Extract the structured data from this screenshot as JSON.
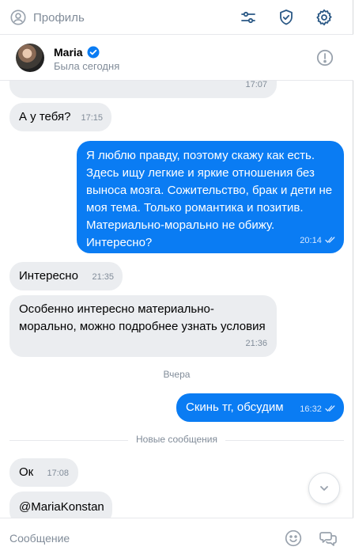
{
  "topbar": {
    "profile_label": "Профиль",
    "icons": [
      "user-circle-icon",
      "sliders-icon",
      "shield-check-icon",
      "gear-icon"
    ]
  },
  "chat": {
    "name": "Maria",
    "verified": true,
    "status": "Была сегодня"
  },
  "messages": [
    {
      "dir": "in",
      "text": "",
      "time": "17:07"
    },
    {
      "dir": "in",
      "text": "А у тебя?",
      "time": "17:15"
    },
    {
      "dir": "out",
      "lines": [
        "Я люблю правду, поэтому скажу как есть.",
        "Здесь ищу легкие и яркие отношения без",
        "выноса мозга. Сожительство, брак и дети не",
        "моя тема. Только романтика и позитив.",
        "Материально-морально не обижу.",
        "Интересно?"
      ],
      "time": "20:14",
      "read": true
    },
    {
      "dir": "in",
      "text": "Интересно",
      "time": "21:35"
    },
    {
      "dir": "in",
      "lines": [
        "Особенно интересно материально-",
        "морально, можно подробнее узнать условия"
      ],
      "time": "21:36"
    },
    {
      "dir": "out",
      "text": "Скинь тг, обсудим",
      "time": "16:32",
      "read": true
    },
    {
      "dir": "in",
      "text": "Ок",
      "time": "17:08"
    },
    {
      "dir": "in",
      "text": "@MariaKonstan",
      "time": ""
    }
  ],
  "dividers": {
    "date": "Вчера",
    "new_messages": "Новые сообщения"
  },
  "composer": {
    "placeholder": "Сообщение"
  },
  "colors": {
    "outgoing": "#0a7cf3",
    "incoming": "#ebedf0",
    "accent": "#2a5885"
  }
}
